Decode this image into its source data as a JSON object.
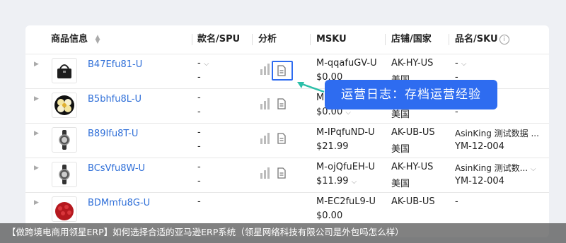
{
  "headers": {
    "product_info": "商品信息",
    "model_spu": "款名/SPU",
    "analysis": "分析",
    "msku": "MSKU",
    "store_country": "店铺/国家",
    "brand_sku": "品名/SKU"
  },
  "rows": [
    {
      "name": "B47Efu81-U",
      "model_1": "-",
      "model_2": "-",
      "msku": "M-qqafuGV-U",
      "price": "$0.00",
      "store": "AK-HY-US",
      "country": "美国",
      "brand": "-",
      "sku": "-"
    },
    {
      "name": "B5bhfu8L-U",
      "model_1": "-",
      "model_2": "-",
      "msku": "M",
      "price": "$0.00",
      "store": "",
      "country": "美国",
      "brand": "",
      "sku": "-"
    },
    {
      "name": "B89Ifu8T-U",
      "model_1": "-",
      "model_2": "-",
      "msku": "M-IPqfuND-U",
      "price": "$21.99",
      "store": "AK-UB-US",
      "country": "美国",
      "brand": "AsinKing 测试数据 ...",
      "sku": "YM-12-004"
    },
    {
      "name": "BCsVfu8W-U",
      "model_1": "-",
      "model_2": "-",
      "msku": "M-ojQfuEH-U",
      "price": "$11.99",
      "store": "AK-HY-US",
      "country": "美国",
      "brand": "AsinKing 测试数...",
      "sku": "YM-12-004"
    },
    {
      "name": "BDMmfu8G-U",
      "model_1": "-",
      "model_2": "",
      "msku": "M-EC2fuL9-U",
      "price": "$0.00",
      "store": "AK-UB-US",
      "country": "",
      "brand": "-",
      "sku": ""
    }
  ],
  "tooltip": "运营日志：存档运营经验",
  "banner": "【做跨境电商用领星ERP】如何选择合适的亚马逊ERP系统（领星网络科技有限公司是外包吗怎么样）",
  "colors": {
    "accent": "#2e6cf0",
    "link": "#2f6fd8",
    "banner_bg": "#505050"
  }
}
